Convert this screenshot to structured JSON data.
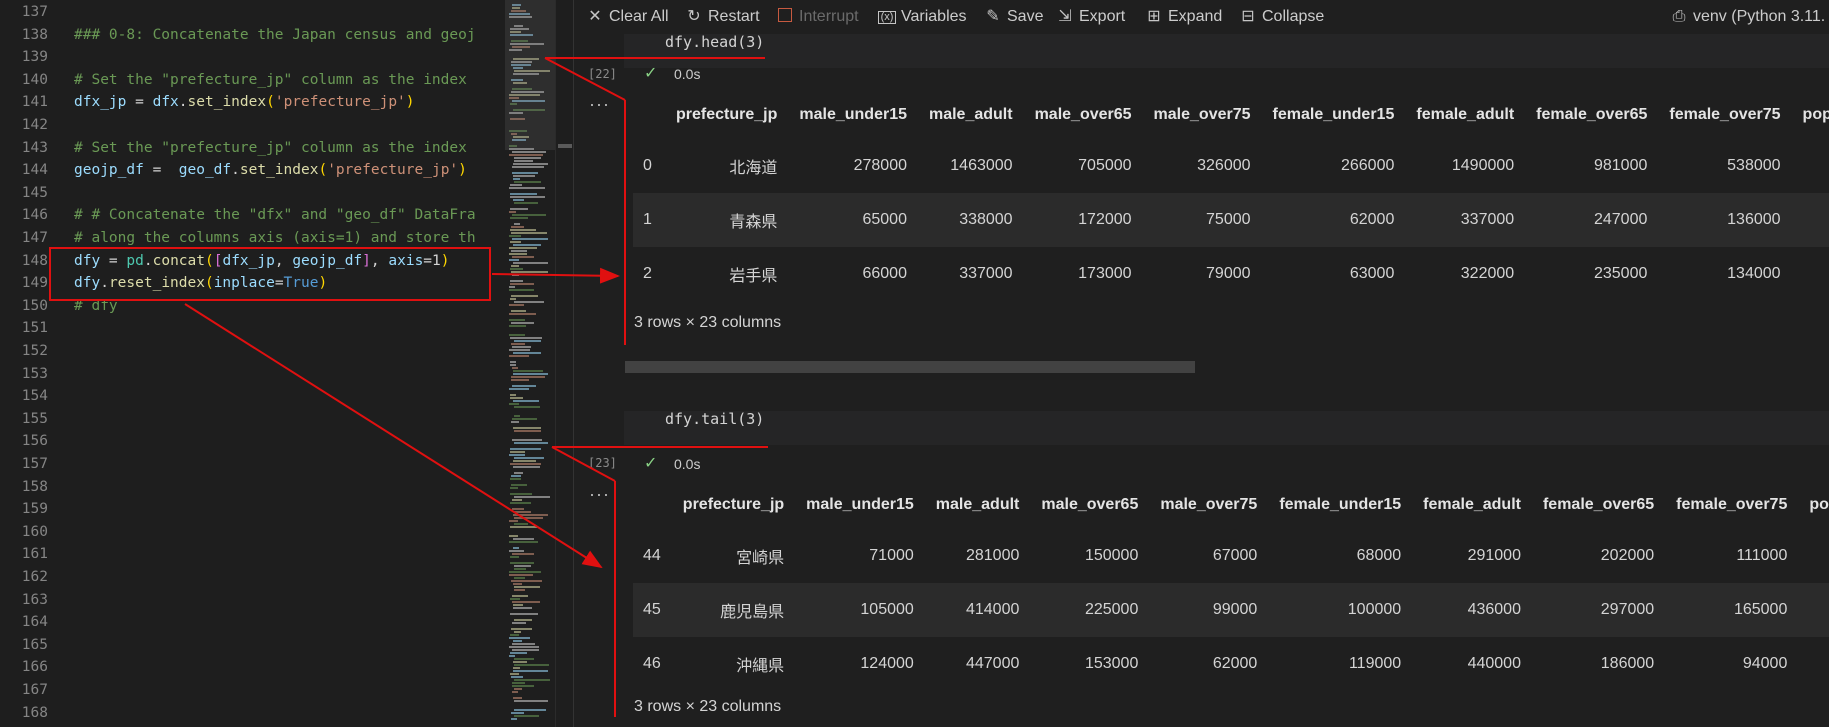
{
  "editor": {
    "lines": [
      {
        "n": "137",
        "tokens": []
      },
      {
        "n": "138",
        "tokens": [
          {
            "t": "### 0-8: Concatenate the Japan census and geoj",
            "c": "comment"
          }
        ]
      },
      {
        "n": "139",
        "tokens": []
      },
      {
        "n": "140",
        "tokens": [
          {
            "t": "# Set the \"prefecture_jp\" column as the index",
            "c": "comment"
          }
        ]
      },
      {
        "n": "141",
        "tokens": [
          {
            "t": "dfx_jp",
            "c": "var"
          },
          {
            "t": " = ",
            "c": "op"
          },
          {
            "t": "dfx",
            "c": "var"
          },
          {
            "t": ".",
            "c": "op"
          },
          {
            "t": "set_index",
            "c": "func"
          },
          {
            "t": "(",
            "c": "brk1"
          },
          {
            "t": "'prefecture_jp'",
            "c": "str"
          },
          {
            "t": ")",
            "c": "brk1"
          }
        ]
      },
      {
        "n": "142",
        "tokens": []
      },
      {
        "n": "143",
        "tokens": [
          {
            "t": "# Set the \"prefecture_jp\" column as the index",
            "c": "comment"
          }
        ]
      },
      {
        "n": "144",
        "tokens": [
          {
            "t": "geojp_df",
            "c": "var"
          },
          {
            "t": " =  ",
            "c": "op"
          },
          {
            "t": "geo_df",
            "c": "var"
          },
          {
            "t": ".",
            "c": "op"
          },
          {
            "t": "set_index",
            "c": "func"
          },
          {
            "t": "(",
            "c": "brk1"
          },
          {
            "t": "'prefecture_jp'",
            "c": "str"
          },
          {
            "t": ")",
            "c": "brk1"
          }
        ]
      },
      {
        "n": "145",
        "tokens": []
      },
      {
        "n": "146",
        "tokens": [
          {
            "t": "# # Concatenate the \"dfx\" and \"geo_df\" DataFra",
            "c": "comment"
          }
        ]
      },
      {
        "n": "147",
        "tokens": [
          {
            "t": "# along the columns axis (axis=1) and store th",
            "c": "comment"
          }
        ]
      },
      {
        "n": "148",
        "tokens": [
          {
            "t": "dfy",
            "c": "var"
          },
          {
            "t": " = ",
            "c": "op"
          },
          {
            "t": "pd",
            "c": "mod"
          },
          {
            "t": ".",
            "c": "op"
          },
          {
            "t": "concat",
            "c": "func"
          },
          {
            "t": "(",
            "c": "brk1"
          },
          {
            "t": "[",
            "c": "brk2"
          },
          {
            "t": "dfx_jp",
            "c": "var"
          },
          {
            "t": ", ",
            "c": "op"
          },
          {
            "t": "geojp_df",
            "c": "var"
          },
          {
            "t": "]",
            "c": "brk2"
          },
          {
            "t": ", ",
            "c": "op"
          },
          {
            "t": "axis",
            "c": "var"
          },
          {
            "t": "=1",
            "c": "op"
          },
          {
            "t": ")",
            "c": "brk1"
          }
        ]
      },
      {
        "n": "149",
        "tokens": [
          {
            "t": "dfy",
            "c": "var"
          },
          {
            "t": ".",
            "c": "op"
          },
          {
            "t": "reset_index",
            "c": "func"
          },
          {
            "t": "(",
            "c": "brk1"
          },
          {
            "t": "inplace",
            "c": "var"
          },
          {
            "t": "=",
            "c": "op"
          },
          {
            "t": "True",
            "c": "kw"
          },
          {
            "t": ")",
            "c": "brk1"
          }
        ]
      },
      {
        "n": "150",
        "tokens": [
          {
            "t": "# dfy",
            "c": "comment"
          }
        ]
      },
      {
        "n": "151",
        "tokens": []
      },
      {
        "n": "152",
        "tokens": []
      },
      {
        "n": "153",
        "tokens": []
      },
      {
        "n": "154",
        "tokens": []
      },
      {
        "n": "155",
        "tokens": []
      },
      {
        "n": "156",
        "tokens": []
      },
      {
        "n": "157",
        "tokens": []
      },
      {
        "n": "158",
        "tokens": []
      },
      {
        "n": "159",
        "tokens": []
      },
      {
        "n": "160",
        "tokens": []
      },
      {
        "n": "161",
        "tokens": []
      },
      {
        "n": "162",
        "tokens": []
      },
      {
        "n": "163",
        "tokens": []
      },
      {
        "n": "164",
        "tokens": []
      },
      {
        "n": "165",
        "tokens": []
      },
      {
        "n": "166",
        "tokens": []
      },
      {
        "n": "167",
        "tokens": []
      },
      {
        "n": "168",
        "tokens": []
      }
    ]
  },
  "toolbar": {
    "clear_all": "Clear All",
    "restart": "Restart",
    "interrupt": "Interrupt",
    "variables": "Variables",
    "save": "Save",
    "export": "Export",
    "expand": "Expand",
    "collapse": "Collapse",
    "kernel": "venv (Python 3.11."
  },
  "cells": [
    {
      "code": "dfy.head(3)",
      "exec_count": "[22]",
      "exec_time": "0.0s",
      "output_dots": "···",
      "columns": [
        "",
        "prefecture_jp",
        "male_under15",
        "male_adult",
        "male_over65",
        "male_over75",
        "female_under15",
        "female_adult",
        "female_over65",
        "female_over75",
        "pop"
      ],
      "rows": [
        [
          "0",
          "北海道",
          "278000",
          "1463000",
          "705000",
          "326000",
          "266000",
          "1490000",
          "981000",
          "538000",
          ""
        ],
        [
          "1",
          "青森県",
          "65000",
          "338000",
          "172000",
          "75000",
          "62000",
          "337000",
          "247000",
          "136000",
          ""
        ],
        [
          "2",
          "岩手県",
          "66000",
          "337000",
          "173000",
          "79000",
          "63000",
          "322000",
          "235000",
          "134000",
          ""
        ]
      ],
      "summary": "3 rows × 23 columns"
    },
    {
      "code": "dfy.tail(3)",
      "exec_count": "[23]",
      "exec_time": "0.0s",
      "output_dots": "···",
      "columns": [
        "",
        "prefecture_jp",
        "male_under15",
        "male_adult",
        "male_over65",
        "male_over75",
        "female_under15",
        "female_adult",
        "female_over65",
        "female_over75",
        "po"
      ],
      "rows": [
        [
          "44",
          "宮崎県",
          "71000",
          "281000",
          "150000",
          "67000",
          "68000",
          "291000",
          "202000",
          "111000",
          ""
        ],
        [
          "45",
          "鹿児島県",
          "105000",
          "414000",
          "225000",
          "99000",
          "100000",
          "436000",
          "297000",
          "165000",
          ""
        ],
        [
          "46",
          "沖縄県",
          "124000",
          "447000",
          "153000",
          "62000",
          "119000",
          "440000",
          "186000",
          "94000",
          ""
        ]
      ],
      "summary": "3 rows × 23 columns"
    }
  ],
  "colors": {
    "annotation": "#e01010",
    "check": "#89d185"
  }
}
